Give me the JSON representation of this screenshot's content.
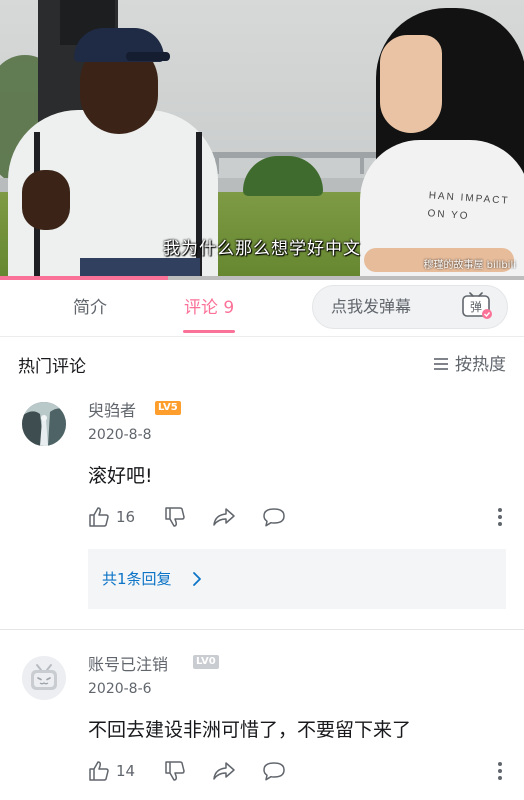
{
  "video": {
    "subtitle": "我为什么那么想学好中文",
    "watermark": "穆瑾的故事屋 bilibili",
    "shirt_text": "HAN IMPACT\nON YO",
    "progress": 0.32,
    "progress_color": "#fb7299"
  },
  "tabs": {
    "intro": "简介",
    "comments": "评论 9",
    "active": "comments",
    "accent": "#fb7299"
  },
  "danmaku": {
    "placeholder": "点我发弹幕",
    "icon": "danmaku-toggle-icon",
    "icon_glyph": "弹"
  },
  "hot_comments": {
    "title": "热门评论",
    "sort_label": "按热度",
    "sort_icon": "list-sort-icon"
  },
  "comments": [
    {
      "username": "臾驺者",
      "level": "LV5",
      "level_color": "#ff9e2c",
      "date": "2020-8-8",
      "content": "滚好吧!",
      "likes": "16",
      "replies_label": "共1条回复"
    },
    {
      "username": "账号已注销",
      "level": "LV0",
      "level_color": "#c9ccd0",
      "date": "2020-8-6",
      "content": "不回去建设非洲可惜了，不要留下来了",
      "likes": "14"
    }
  ]
}
